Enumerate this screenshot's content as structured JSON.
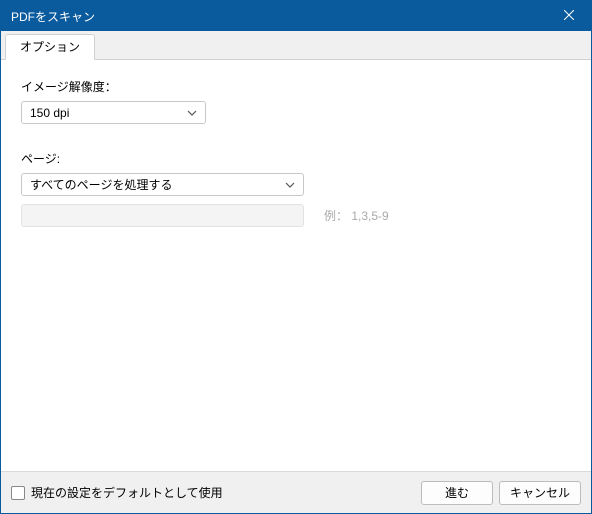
{
  "window": {
    "title": "PDFをスキャン"
  },
  "tabs": {
    "options": "オプション"
  },
  "fields": {
    "resolution": {
      "label": "イメージ解像度：",
      "value": "150 dpi"
    },
    "pages": {
      "label": "ページ:",
      "value": "すべてのページを処理する"
    },
    "range_example": "例： 1,3,5-9"
  },
  "footer": {
    "default_checkbox": "現在の設定をデフォルトとして使用",
    "proceed": "進む",
    "cancel": "キャンセル"
  }
}
